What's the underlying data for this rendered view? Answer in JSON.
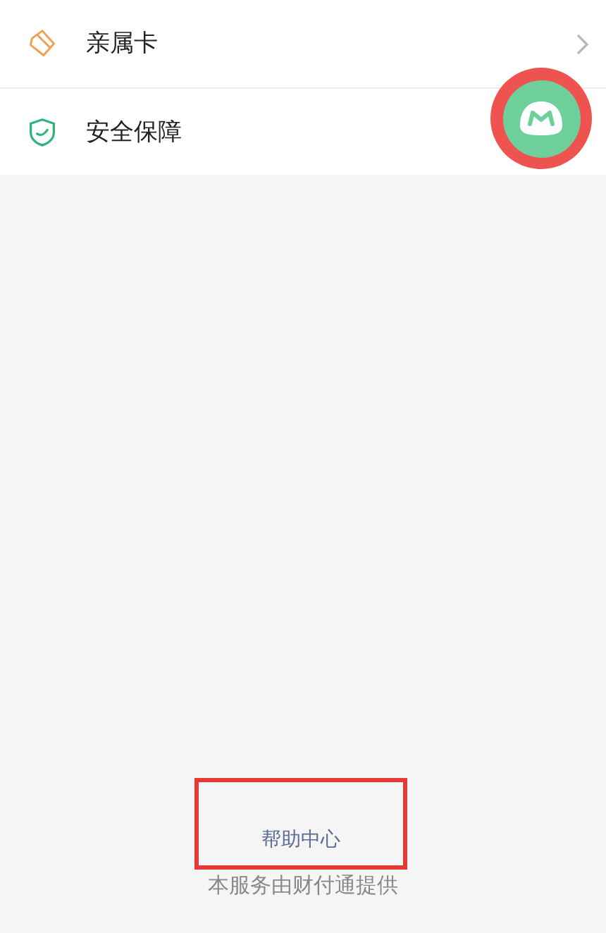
{
  "menu_items": [
    {
      "label": "亲属卡"
    },
    {
      "label": "安全保障"
    }
  ],
  "footer": {
    "help_link": "帮助中心",
    "provider_note": "本服务由财付通提供"
  }
}
